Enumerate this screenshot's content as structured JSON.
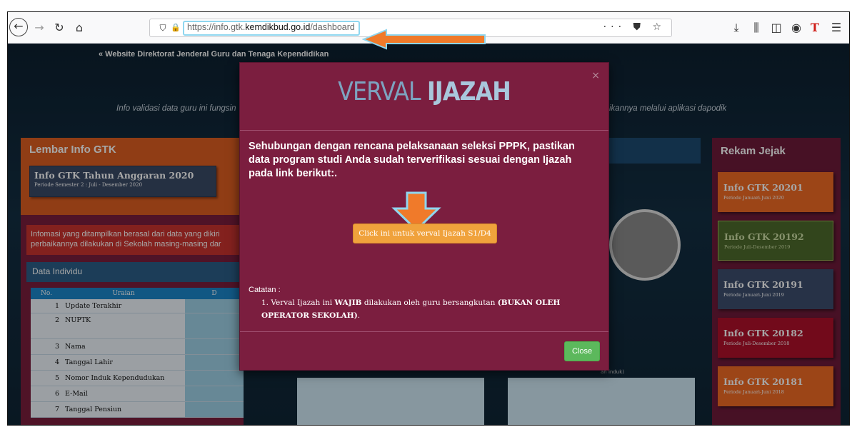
{
  "browser": {
    "url_prefix": "https://info.gtk.",
    "url_domain": "kemdikbud.go.id",
    "url_path": "/dashboard",
    "url_dots": "···"
  },
  "page": {
    "site_link": "« Website Direktorat Jenderal Guru dan Tenaga Kependidikan",
    "subtitle_left": "Info validasi data guru ini fungsin",
    "subtitle_right": "ikannya melalui aplikasi dapodik",
    "left_panel_title": "Lembar Info GTK",
    "info_card_title": "Info GTK Tahun Anggaran 2020",
    "info_card_period": "Periode Semester 2 : Juli - Desember 2020",
    "notice_line1": "Infomasi yang ditampilkan berasal dari data yang dikiri",
    "notice_line2": "perbaikannya dilakukan di Sekolah masing-masing dar",
    "data_individu_title": "Data Individu",
    "table_headers": [
      "No.",
      "Uraian",
      "D"
    ],
    "table_rows": [
      {
        "no": "1",
        "label": "Update Terakhir"
      },
      {
        "no": "2",
        "label": "NUPTK"
      },
      {
        "no": "3",
        "label": "Nama"
      },
      {
        "no": "4",
        "label": "Tanggal Lahir"
      },
      {
        "no": "5",
        "label": "Nomor Induk Kependudukan"
      },
      {
        "no": "6",
        "label": "E-Mail"
      },
      {
        "no": "7",
        "label": "Tanggal Pensiun"
      }
    ],
    "middle_fragment": "ah induk)"
  },
  "rekam_jejak": {
    "title": "Rekam Jejak",
    "items": [
      {
        "title": "Info GTK 20201",
        "period": "Periode Januari-Juni 2020",
        "color": "#f06a24"
      },
      {
        "title": "Info GTK 20192",
        "period": "Periode Juli-Desember 2019",
        "color": "#4e6b2c"
      },
      {
        "title": "Info GTK 20191",
        "period": "Periode Januari-Juni 2019",
        "color": "#3d4e6e"
      },
      {
        "title": "Info GTK 20182",
        "period": "Periode Juli-Desember 2018",
        "color": "#b0102a"
      },
      {
        "title": "Info GTK 20181",
        "period": "Periode Januari-Juni 2018",
        "color": "#f06a24"
      }
    ]
  },
  "modal": {
    "title_part1": "VERVAL",
    "title_part2": "IJAZAH",
    "close_x": "×",
    "body": "Sehubungan dengan rencana pelaksanaan seleksi PPPK, pastikan data program studi Anda sudah terverifikasi sesuai dengan Ijazah pada link berikut:.",
    "verval_button": "Click ini untuk verval Ijazah S1/D4",
    "catatan_label": "Catatan :",
    "catatan_1": "1. Verval Ijazah ini ",
    "catatan_bold1": "WAJIB",
    "catatan_2": " dilakukan oleh guru bersangkutan ",
    "catatan_bold2": "(BUKAN OLEH OPERATOR SEKOLAH)",
    "catatan_end": ".",
    "close_button": "Close"
  },
  "colors": {
    "modal_bg": "#7b1e3f",
    "accent_orange": "#f0a23c",
    "arrow": "#f07a2a",
    "close_green": "#5cb85c"
  }
}
